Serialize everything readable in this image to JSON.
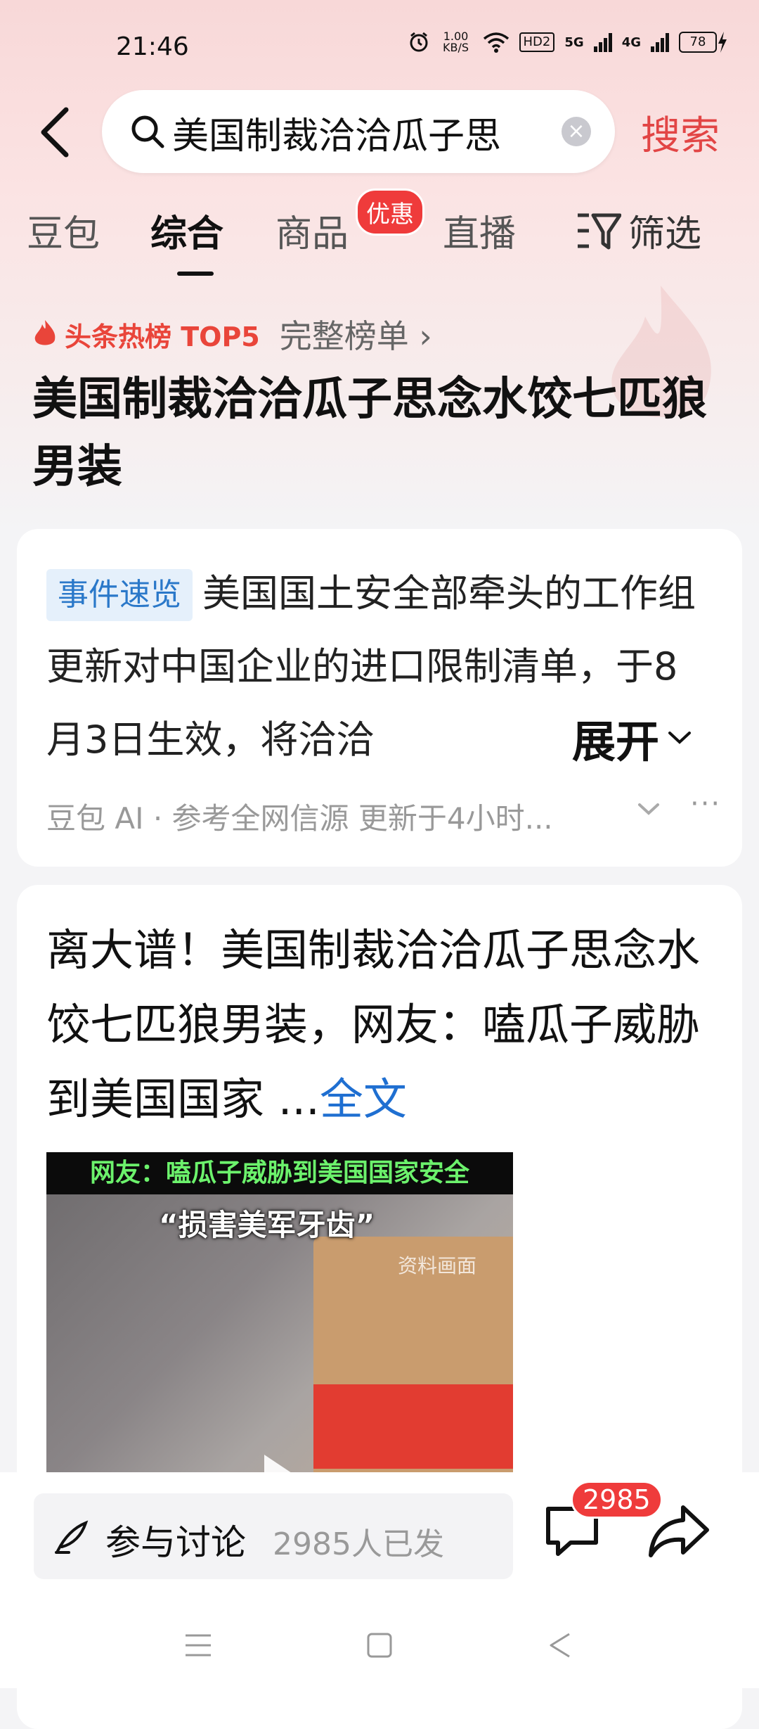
{
  "status": {
    "time": "21:46",
    "speed": "1.00 KB/S",
    "hd": "HD2",
    "net1": "5G",
    "net2": "4G",
    "battery": "78"
  },
  "search": {
    "query": "美国制裁洽洽瓜子思",
    "button": "搜索"
  },
  "tabs": [
    {
      "label": "豆包"
    },
    {
      "label": "综合"
    },
    {
      "label": "商品"
    },
    {
      "label": "直播"
    }
  ],
  "tab_badge": "优惠",
  "filter_label": "筛选",
  "hot": {
    "label": "头条热榜 TOP5",
    "link": "完整榜单 ›",
    "title": "美国制裁洽洽瓜子思念水饺七匹狼男装"
  },
  "ai_card": {
    "tag": "事件速览",
    "text": "美国国土安全部牵头的工作组更新对中国企业的进口限制清单，于8月3日生效，将洽洽",
    "expand": "展开",
    "source": "豆包 AI · 参考全网信源 更新于4小时...",
    "more": "···"
  },
  "news_card": {
    "title": "离大谱！美国制裁洽洽瓜子思念水饺七匹狼男装，网友：嗑瓜子威胁到美国国家 ...",
    "read_full": "全文",
    "video_caption_top": "网友：嗑瓜子威胁到美国国家安全",
    "video_caption_2": "“损害美军牙齿”",
    "video_archive": "资料画面"
  },
  "bottom": {
    "discuss_label": "参与讨论",
    "discuss_count": "2985人已发",
    "comment_badge": "2985"
  },
  "colors": {
    "accent_red": "#e24545",
    "link_blue": "#1f6fd1",
    "tag_blue": "#2a78c9"
  }
}
